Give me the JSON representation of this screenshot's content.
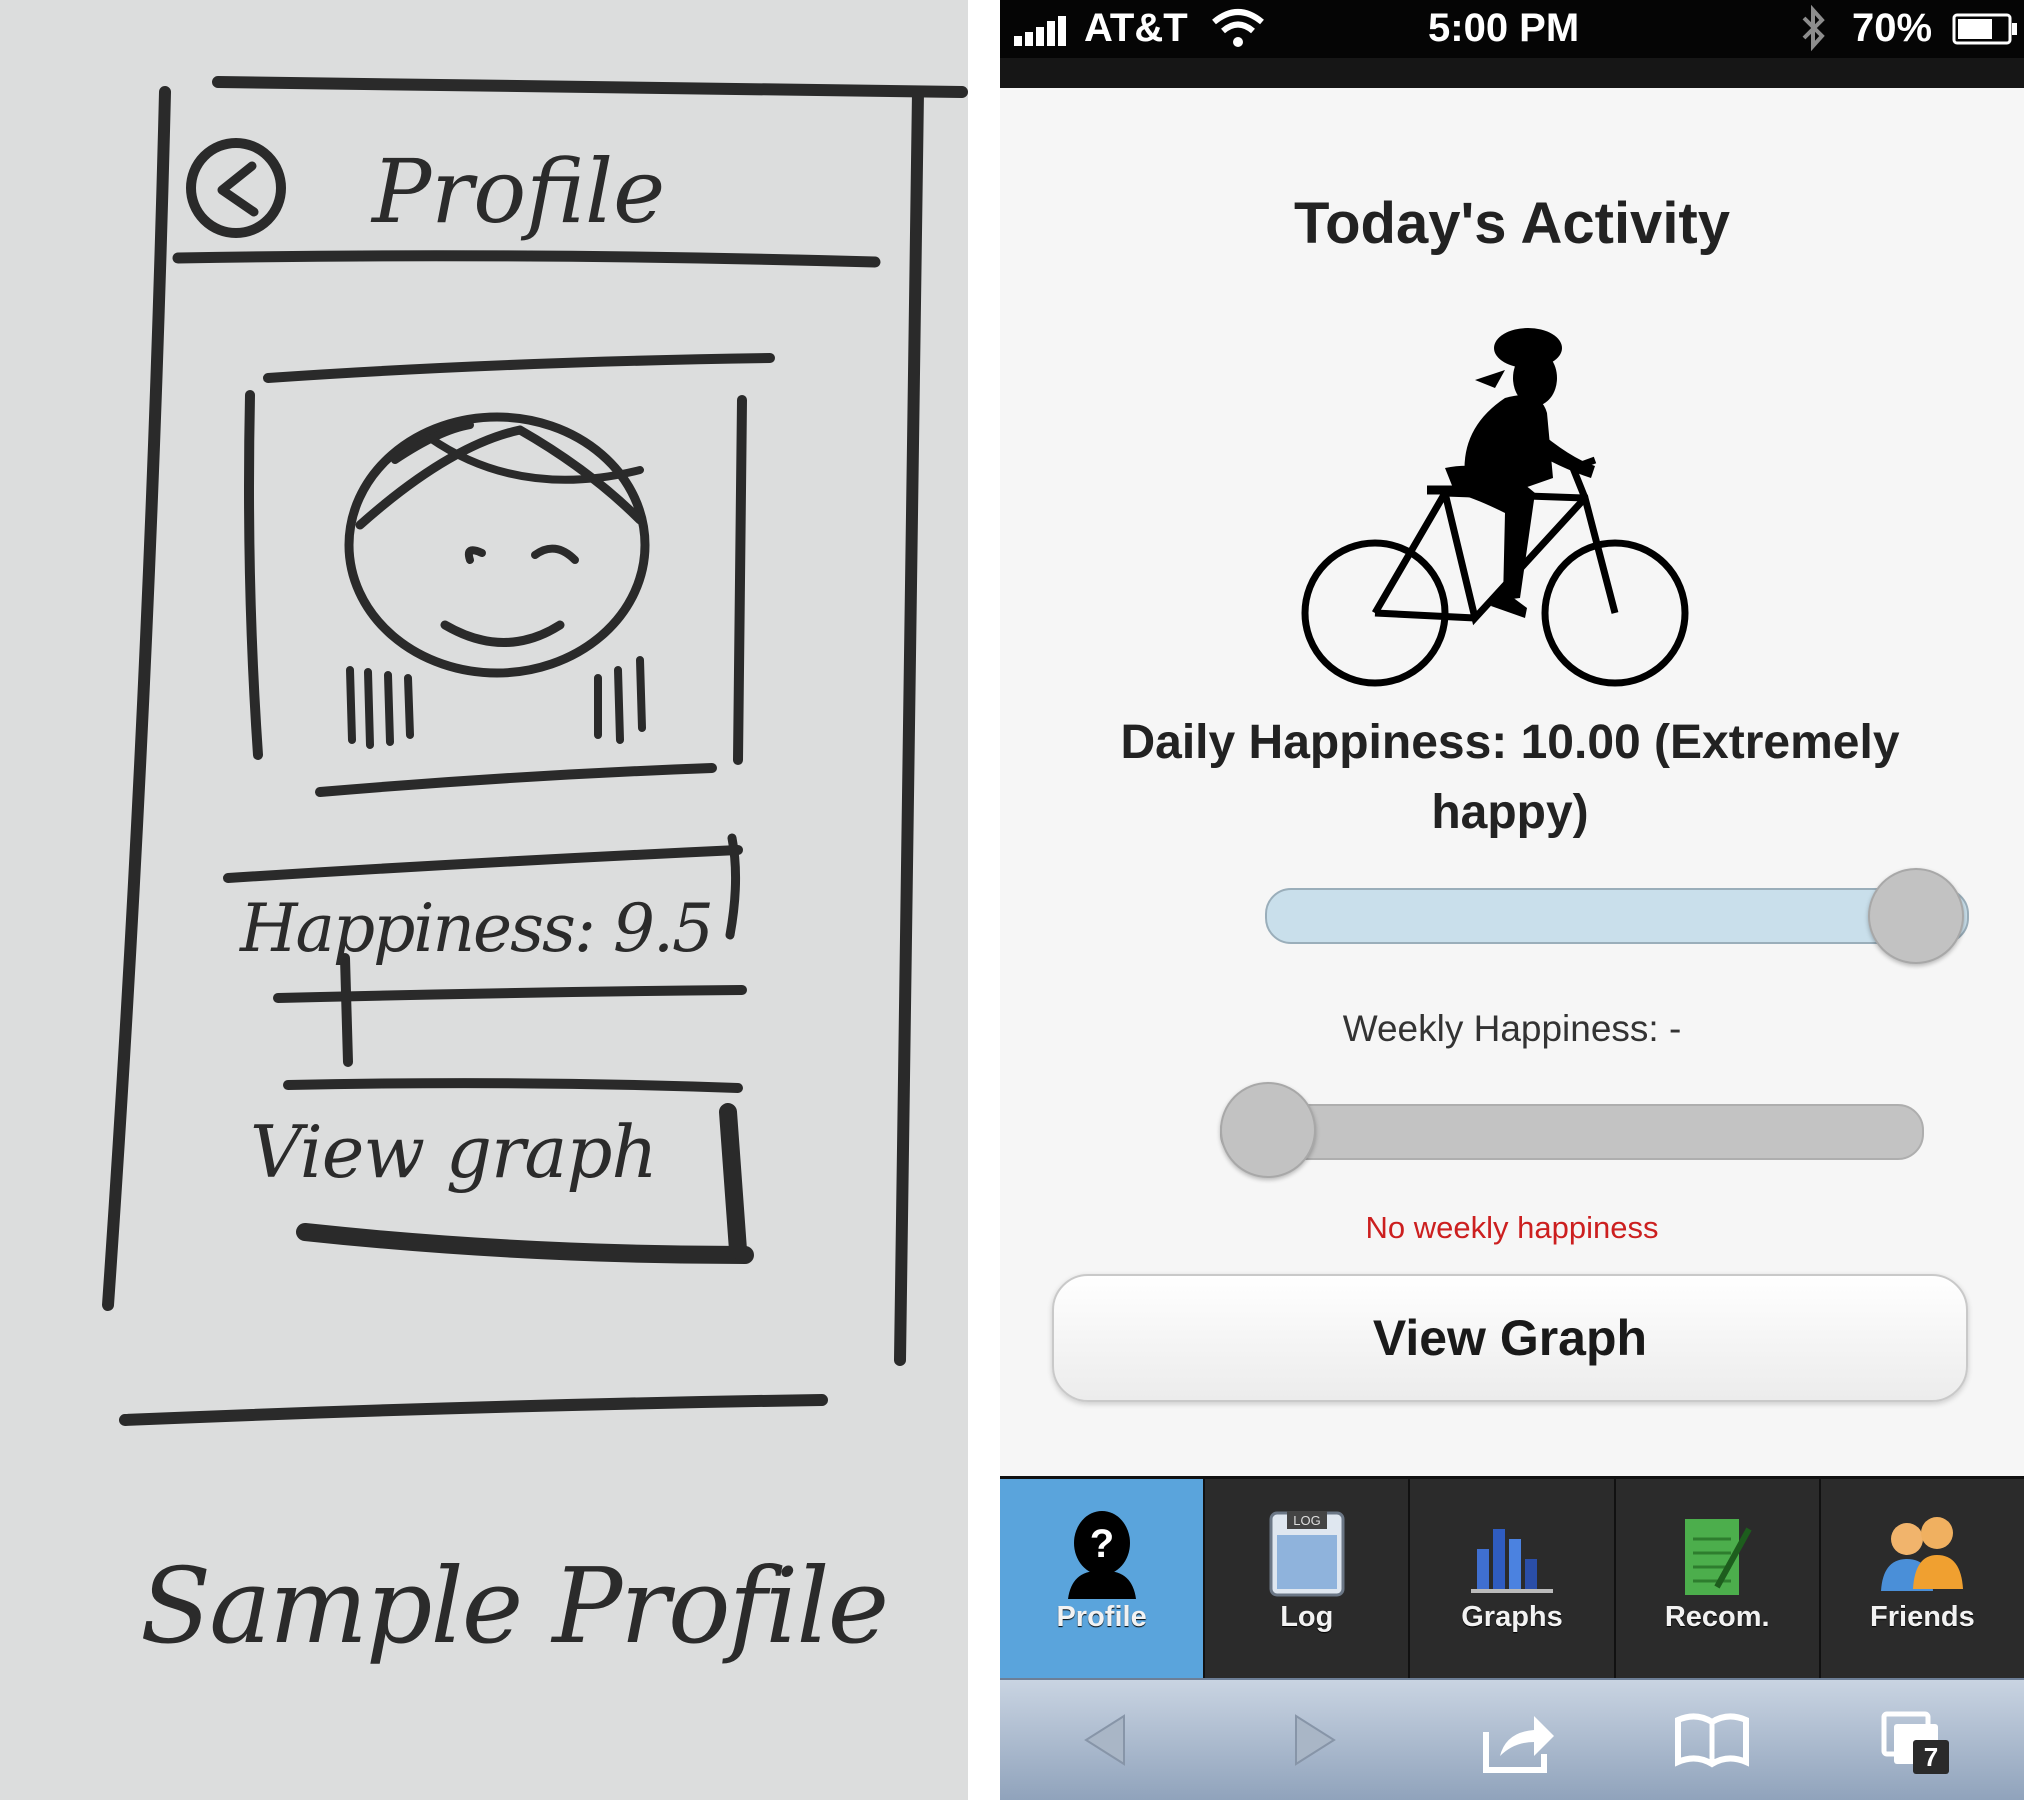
{
  "sketch": {
    "header_title": "Profile",
    "happiness_label": "Happiness: 9.5",
    "view_graph_label": "View graph",
    "caption": "Sample Profile"
  },
  "status_bar": {
    "carrier": "AT&T",
    "time": "5:00 PM",
    "battery": "70%"
  },
  "activity": {
    "title": "Today's Activity",
    "image_icon": "cyclist-icon"
  },
  "daily_happiness": {
    "label": "Daily Happiness: 10.00 (Extremely happy)",
    "slider_value_fraction": 1.0
  },
  "weekly_happiness": {
    "label": "Weekly Happiness: -",
    "slider_value_fraction": 0.0,
    "message": "No weekly happiness",
    "message_color": "#cc1f1f"
  },
  "view_graph_button": "View Graph",
  "tabs": [
    {
      "label": "Profile",
      "icon": "profile-icon",
      "active": true
    },
    {
      "label": "Log",
      "icon": "log-icon",
      "icon_text": "LOG",
      "active": false
    },
    {
      "label": "Graphs",
      "icon": "graphs-icon",
      "active": false
    },
    {
      "label": "Recom.",
      "icon": "recommendation-icon",
      "active": false
    },
    {
      "label": "Friends",
      "icon": "friends-icon",
      "active": false
    }
  ],
  "browser": {
    "tab_count": "7"
  },
  "colors": {
    "tab_active": "#5aa4dc",
    "daily_track": "#c9dfeb",
    "tab_bar": "#2b2b2b"
  }
}
